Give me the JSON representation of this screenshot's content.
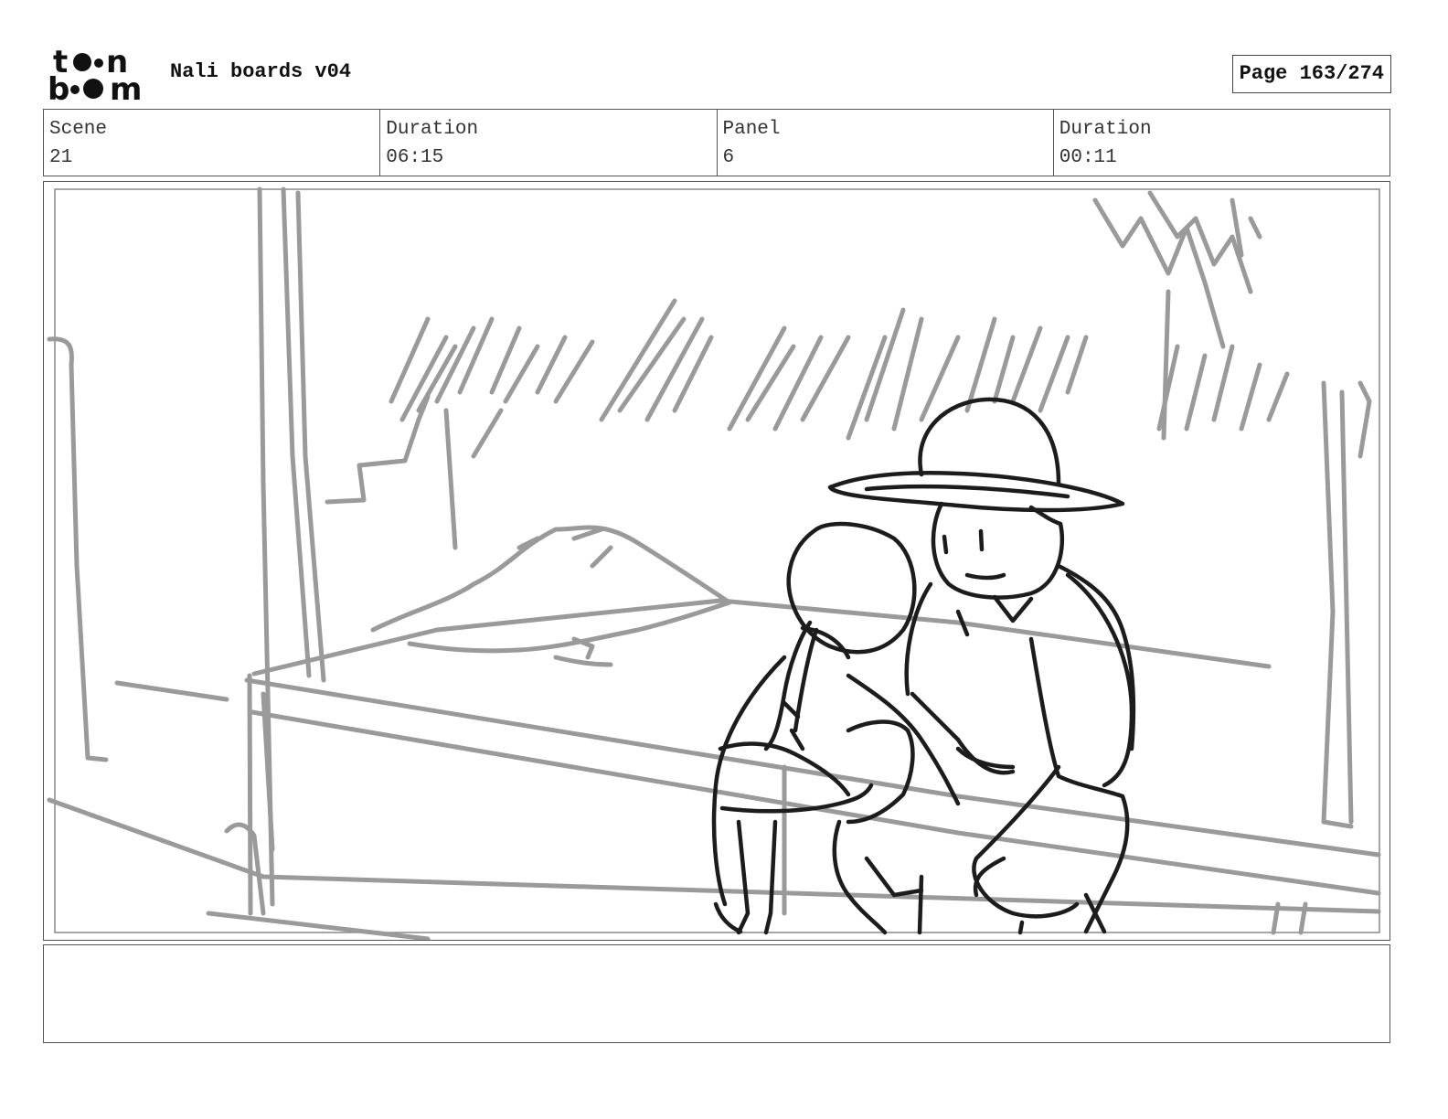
{
  "header": {
    "logo_line1": "toon",
    "logo_line2": "boom",
    "title": "Nali boards v04",
    "page_label": "Page 163/274"
  },
  "info": [
    {
      "label": "Scene",
      "value": "21"
    },
    {
      "label": "Duration",
      "value": "06:15"
    },
    {
      "label": "Panel",
      "value": "6"
    },
    {
      "label": "Duration",
      "value": "00:11"
    }
  ],
  "notes": {
    "text": ""
  }
}
